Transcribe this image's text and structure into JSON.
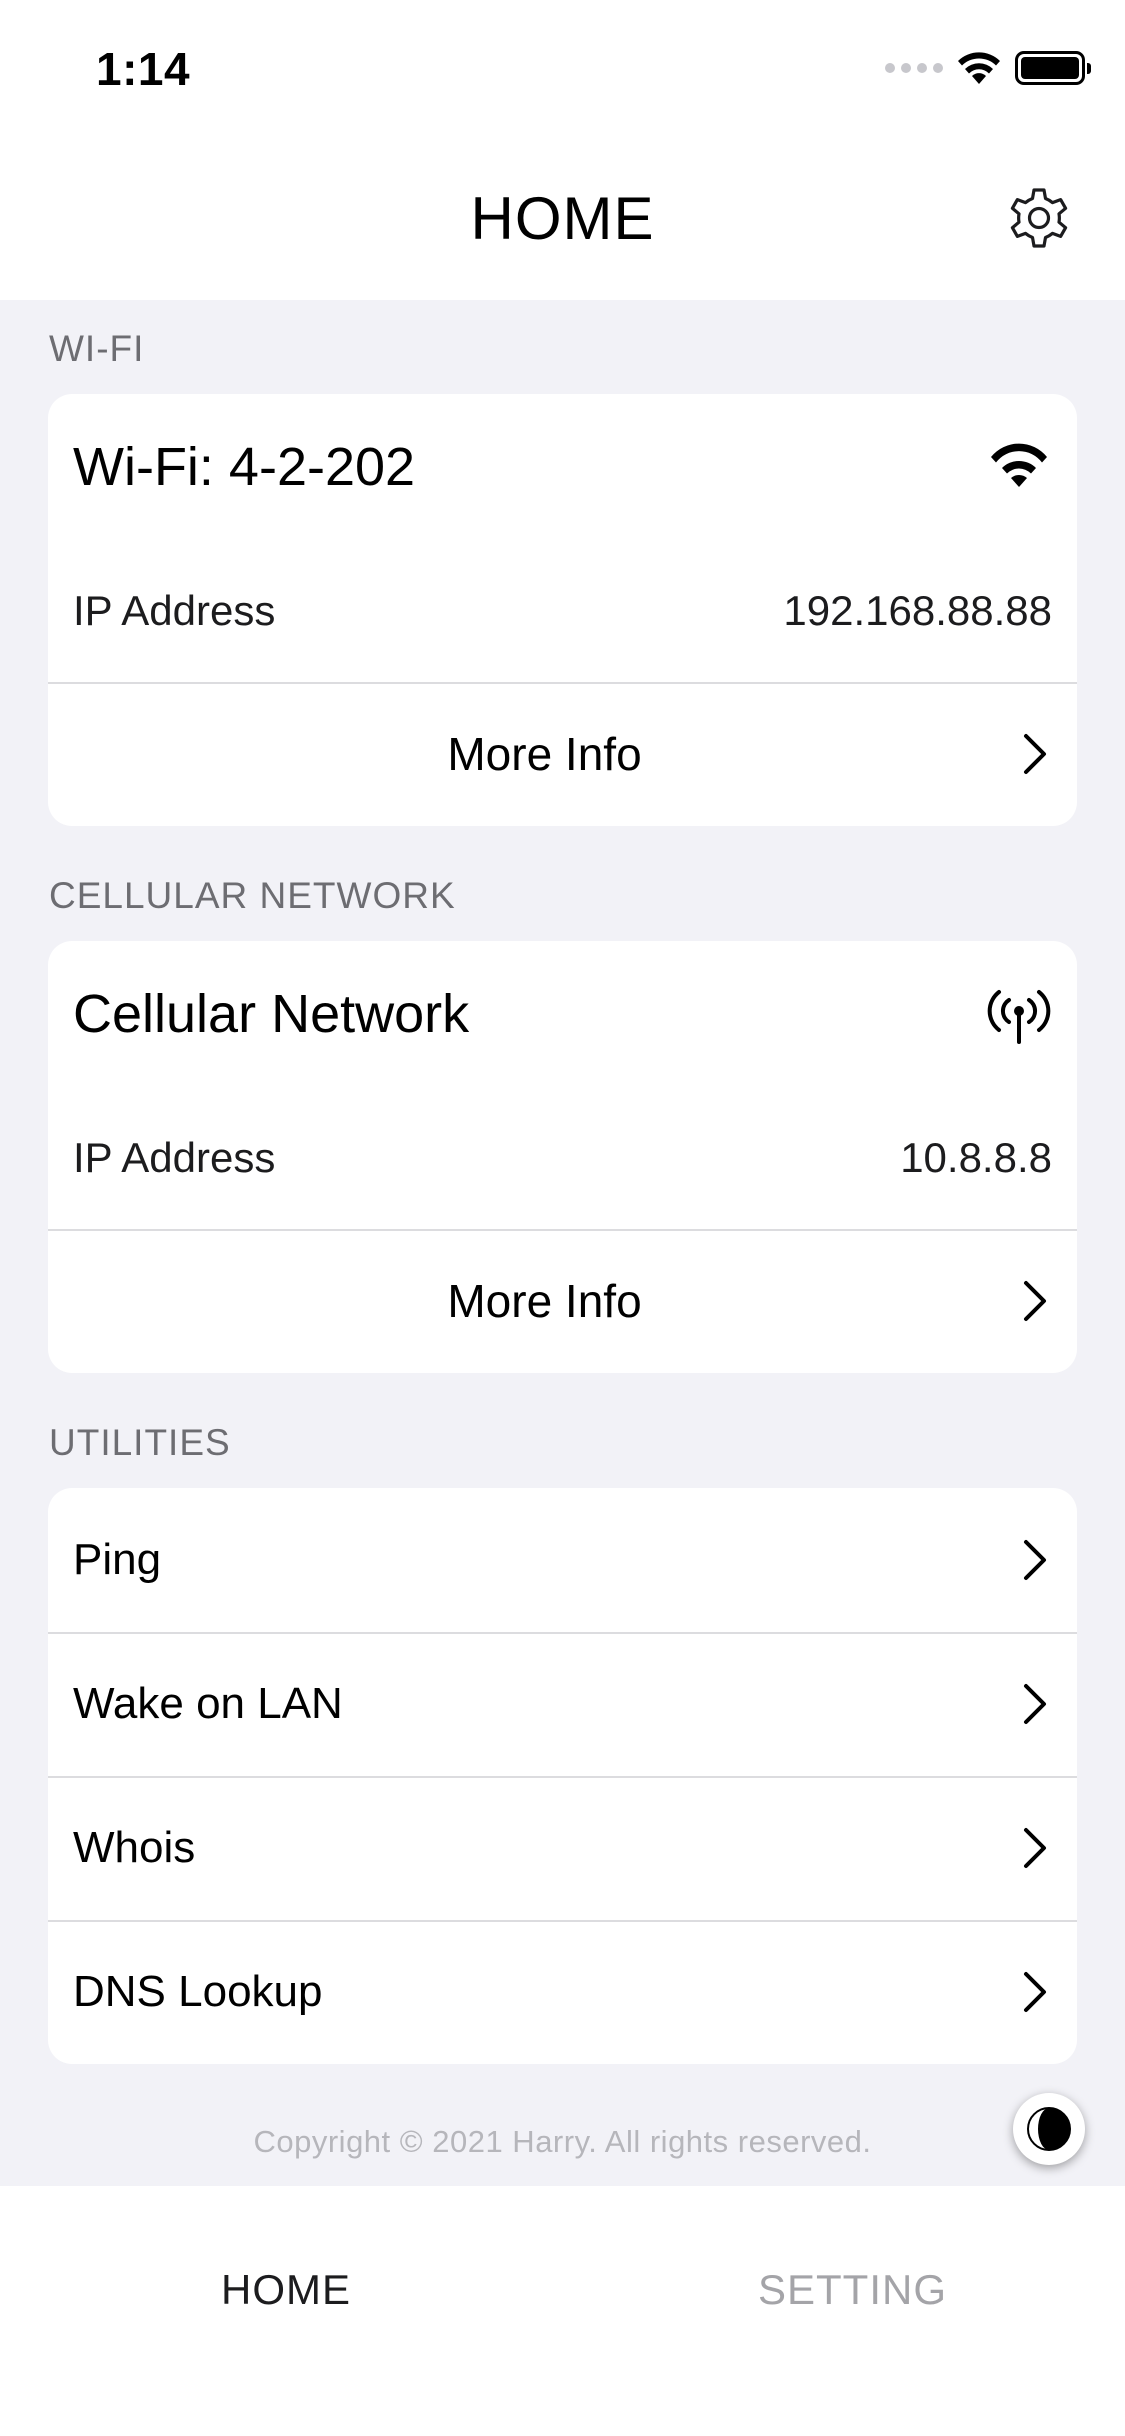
{
  "status_bar": {
    "time": "1:14"
  },
  "nav": {
    "title": "HOME",
    "settings_icon": "gear-icon"
  },
  "wifi_section": {
    "header": "WI-FI",
    "title": "Wi-Fi: 4-2-202",
    "icon": "wifi-icon",
    "ip_label": "IP Address",
    "ip_value": "192.168.88.88",
    "more_info": "More Info"
  },
  "cellular_section": {
    "header": "CELLULAR NETWORK",
    "title": "Cellular Network",
    "icon": "antenna-icon",
    "ip_label": "IP Address",
    "ip_value": "10.8.8.8",
    "more_info": "More Info"
  },
  "utilities_section": {
    "header": "UTILITIES",
    "items": [
      {
        "label": "Ping"
      },
      {
        "label": "Wake on LAN"
      },
      {
        "label": "Whois"
      },
      {
        "label": "DNS Lookup"
      }
    ]
  },
  "footer": {
    "copyright": "Copyright © 2021 Harry. All rights reserved."
  },
  "tab_bar": {
    "home": "HOME",
    "setting": "SETTING"
  },
  "colors": {
    "background": "#f2f2f7",
    "card": "#ffffff",
    "section_header": "#6d6d72",
    "inactive_tab": "#a4a4a8"
  }
}
